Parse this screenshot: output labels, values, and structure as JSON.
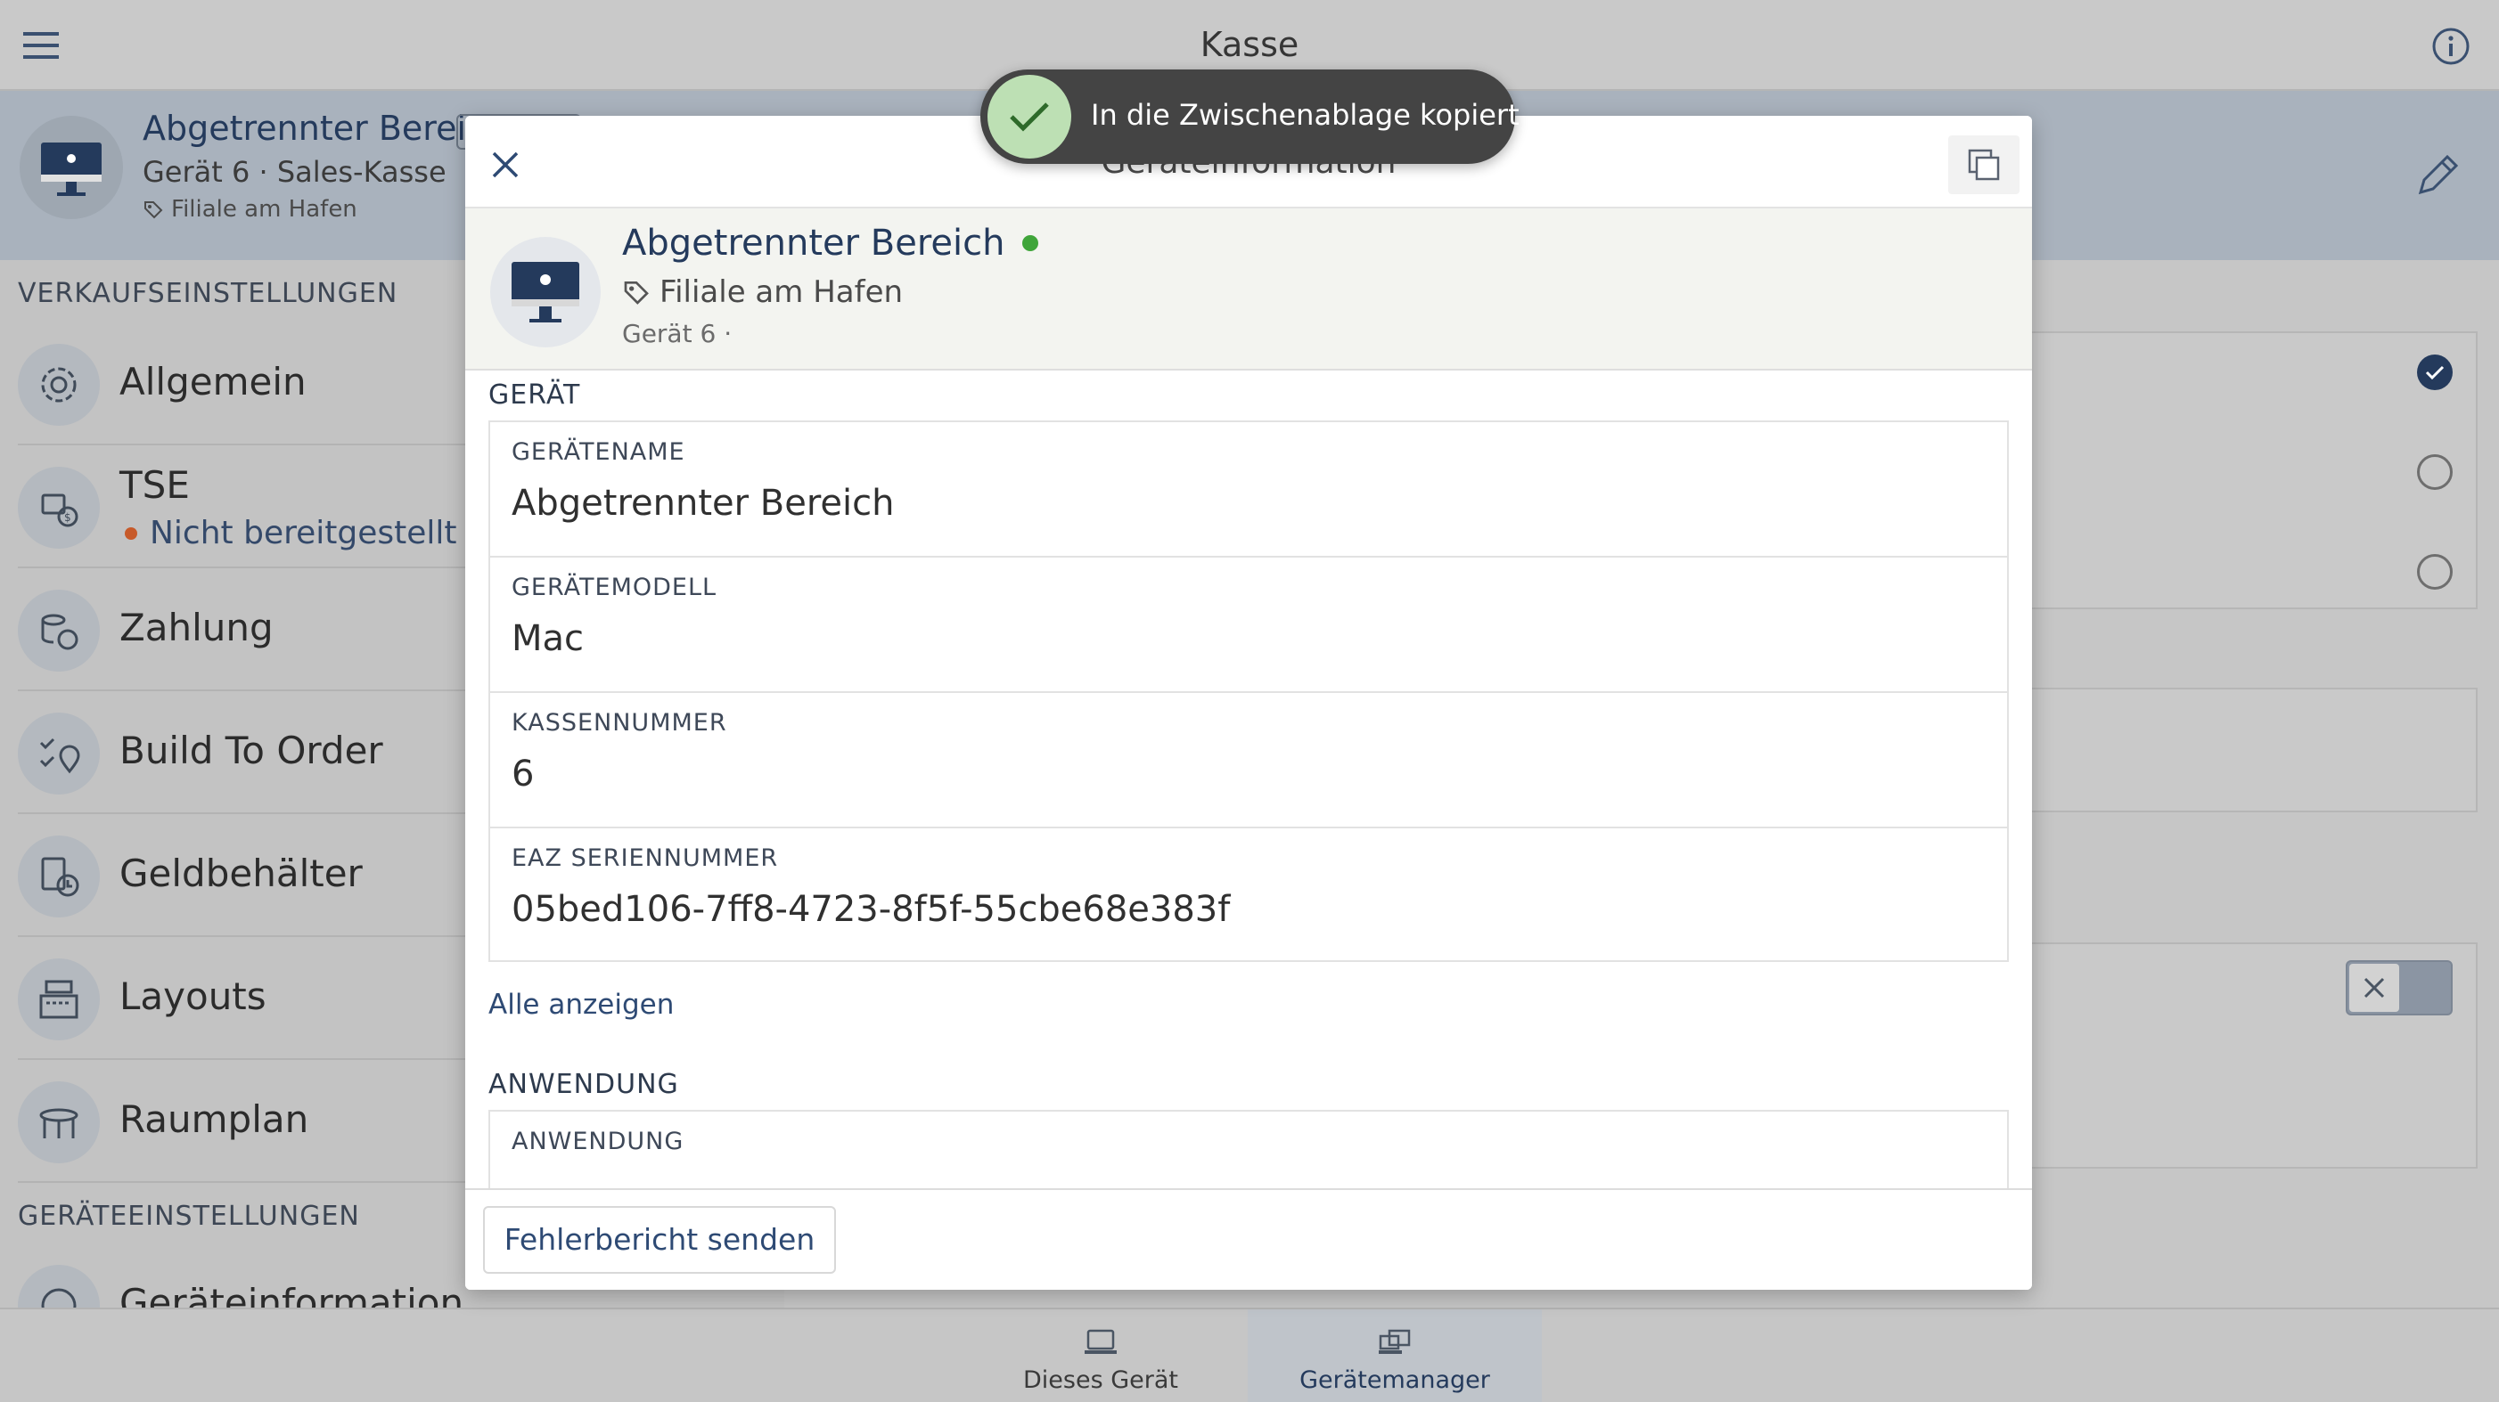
{
  "topbar": {
    "title": "Kasse",
    "menu_icon": "hamburger-menu-icon",
    "info_icon": "info-icon"
  },
  "device_header": {
    "title": "Abgetrennter Bereich",
    "subtitle": "Gerät 6 · Sales-Kasse",
    "location": "Filiale am Hafen"
  },
  "sidebar": {
    "section_sales": "VERKAUFSEINSTELLUNGEN",
    "section_device": "GERÄTEEINSTELLUNGEN",
    "items": [
      {
        "label": "Allgemein",
        "icon": "gear-icon"
      },
      {
        "label": "TSE",
        "status": "Nicht bereitgestellt",
        "status_color": "#c75a2a",
        "icon": "tse-icon"
      },
      {
        "label": "Zahlung",
        "icon": "coins-icon"
      },
      {
        "label": "Build To Order",
        "icon": "checklist-location-icon"
      },
      {
        "label": "Geldbehälter",
        "icon": "cash-drawer-icon"
      },
      {
        "label": "Layouts",
        "icon": "cash-register-icon"
      },
      {
        "label": "Raumplan",
        "icon": "table-icon"
      },
      {
        "label": "Geräteinformation",
        "icon": "info-icon"
      }
    ]
  },
  "modal": {
    "title": "Geräteinformation",
    "device": {
      "name": "Abgetrennter Bereich",
      "status_color": "#3fa53a",
      "location": "Filiale am Hafen",
      "sub": "Gerät 6 ·"
    },
    "section_device": "GERÄT",
    "fields": [
      {
        "label": "GERÄTENAME",
        "value": "Abgetrennter Bereich"
      },
      {
        "label": "GERÄTEMODELL",
        "value": "Mac"
      },
      {
        "label": "KASSENNUMMER",
        "value": "6"
      },
      {
        "label": "EAZ SERIENNUMMER",
        "value": "05bed106-7ff8-4723-8f5f-55cbe68e383f"
      }
    ],
    "show_all": "Alle anzeigen",
    "section_app": "ANWENDUNG",
    "app_field_label": "ANWENDUNG",
    "report_button": "Fehlerbericht senden"
  },
  "toast": {
    "text": "In die Zwischenablage kopiert"
  },
  "bottom_tabs": [
    {
      "label": "Dieses Gerät",
      "icon": "laptop-icon",
      "active": false
    },
    {
      "label": "Gerätemanager",
      "icon": "devices-icon",
      "active": true
    }
  ],
  "colors": {
    "accent": "#243a5c",
    "link": "#2e4a74",
    "success": "#3fa53a"
  }
}
